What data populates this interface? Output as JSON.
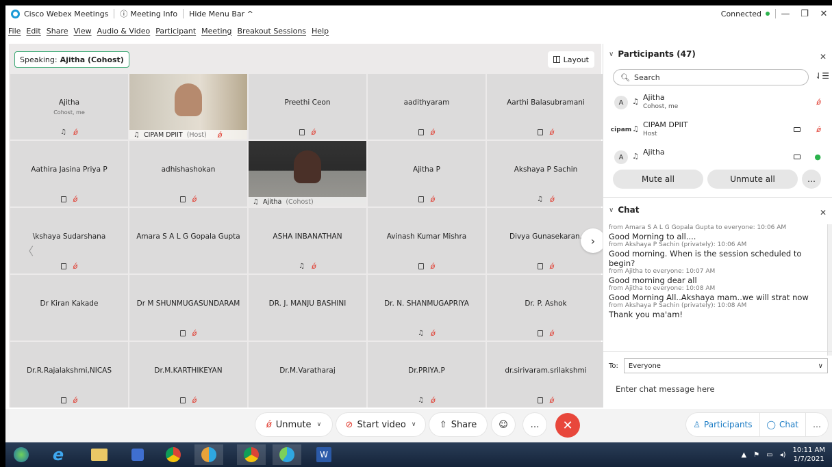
{
  "titlebar": {
    "app_name": "Cisco Webex Meetings",
    "meeting_info": "Meeting Info",
    "hide_menu": "Hide Menu Bar ^",
    "status": "Connected",
    "minimize": "—",
    "restore": "❐",
    "close": "✕"
  },
  "menu": [
    "File",
    "Edit",
    "Share",
    "View",
    "Audio & Video",
    "Participant",
    "Meeting",
    "Breakout Sessions",
    "Help"
  ],
  "speaking": {
    "prefix": "Speaking:",
    "name": "Ajitha (Cohost)"
  },
  "layout_label": "Layout",
  "tiles": [
    {
      "name": "Ajitha",
      "sub": "Cohost, me",
      "icons": [
        "headset",
        "mute"
      ]
    },
    {
      "name": "CIPAM DPIIT",
      "role": "(Host)",
      "video": true
    },
    {
      "name": "Preethi Ceon",
      "icons": [
        "phone",
        "mute"
      ]
    },
    {
      "name": "aadithyaram",
      "icons": [
        "phone",
        "mute"
      ]
    },
    {
      "name": "Aarthi Balasubramani",
      "icons": [
        "phone",
        "mute"
      ]
    },
    {
      "name": "Aathira Jasina Priya P",
      "icons": [
        "phone",
        "mute"
      ]
    },
    {
      "name": "adhishashokan",
      "icons": [
        "phone",
        "mute"
      ]
    },
    {
      "name": "Ajitha",
      "role": "(Cohost)",
      "video": true
    },
    {
      "name": "Ajitha P",
      "icons": [
        "phone",
        "mute"
      ]
    },
    {
      "name": "Akshaya P Sachin",
      "icons": [
        "headset",
        "mute"
      ]
    },
    {
      "name": "\\kshaya Sudarshana",
      "icons": [
        "phone",
        "mute"
      ]
    },
    {
      "name": "Amara S A L G Gopala Gupta",
      "icons": []
    },
    {
      "name": "ASHA INBANATHAN",
      "icons": [
        "headset",
        "mute"
      ]
    },
    {
      "name": "Avinash Kumar Mishra",
      "icons": [
        "phone",
        "mute"
      ]
    },
    {
      "name": "Divya Gunasekaran.",
      "icons": [
        "phone",
        "mute"
      ]
    },
    {
      "name": "Dr Kiran Kakade",
      "icons": []
    },
    {
      "name": "Dr M SHUNMUGASUNDARAM",
      "icons": [
        "phone",
        "mute"
      ]
    },
    {
      "name": "DR. J. MANJU BASHINI",
      "icons": []
    },
    {
      "name": "Dr. N. SHANMUGAPRIYA",
      "icons": [
        "headset",
        "mute"
      ]
    },
    {
      "name": "Dr. P. Ashok",
      "icons": [
        "phone",
        "mute"
      ]
    },
    {
      "name": "Dr.R.Rajalakshmi,NICAS",
      "icons": [
        "phone",
        "mute"
      ]
    },
    {
      "name": "Dr.M.KARTHIKEYAN",
      "icons": [
        "phone",
        "mute"
      ]
    },
    {
      "name": "Dr.M.Varatharaj",
      "icons": []
    },
    {
      "name": "Dr.PRIYA.P",
      "icons": [
        "headset",
        "mute"
      ]
    },
    {
      "name": "dr.sirivaram.srilakshmi",
      "icons": [
        "phone",
        "mute"
      ]
    }
  ],
  "controls": {
    "unmute": "Unmute",
    "start_video": "Start video",
    "share": "Share",
    "participants": "Participants",
    "chat": "Chat"
  },
  "participants_panel": {
    "title": "Participants (47)",
    "search_placeholder": "Search",
    "rows": [
      {
        "avatar": "A",
        "name": "Ajitha",
        "role": "Cohost, me",
        "mic": "muted"
      },
      {
        "avatar": "cipam",
        "name": "CIPAM DPIIT",
        "role": "Host",
        "camera": true,
        "mic": "muted"
      },
      {
        "avatar": "A",
        "name": "Ajitha",
        "role": "",
        "camera": true,
        "mic": "on"
      }
    ],
    "mute_all": "Mute all",
    "unmute_all": "Unmute all"
  },
  "chat_panel": {
    "title": "Chat",
    "messages": [
      {
        "from": "from Amara S A L G Gopala Gupta to everyone:  10:06 AM",
        "text": "Good Morning to all...."
      },
      {
        "from": "from Akshaya P Sachin (privately):  10:06 AM",
        "text": "Good morning. When is the session scheduled to begin?"
      },
      {
        "from": "from Ajitha to everyone:  10:07 AM",
        "text": "Good morning dear all"
      },
      {
        "from": "from Ajitha to everyone:  10:08 AM",
        "text": "Good Morning All..Akshaya mam..we will strat now"
      },
      {
        "from": "from Akshaya P Sachin (privately):  10:08 AM",
        "text": "Thank you ma'am!"
      }
    ],
    "to_label": "To:",
    "to_value": "Everyone",
    "input_placeholder": "Enter chat message here"
  },
  "taskbar": {
    "time": "10:11 AM",
    "date": "1/7/2021"
  }
}
